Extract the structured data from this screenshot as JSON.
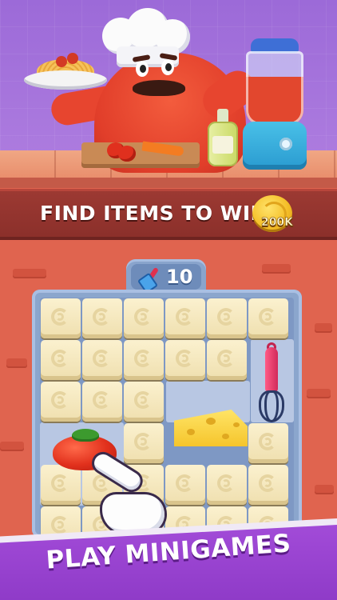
{
  "banner": {
    "text": "FIND ITEMS TO WIN:",
    "reward_amount": "200K",
    "reward_icon": "gold-coin-icon"
  },
  "moves_counter": {
    "icon": "spatula-icon",
    "value": "10"
  },
  "board": {
    "found_items": [
      "tomato",
      "cheese",
      "whisk"
    ]
  },
  "cta": {
    "text": "PLAY MINIGAMES"
  },
  "colors": {
    "banner": "#8a2f2a",
    "scene_wall": "#a87ade",
    "board_frame": "#8ba6cd",
    "cta_purple": "#9b45d2",
    "tile": "#f5e6bb"
  }
}
